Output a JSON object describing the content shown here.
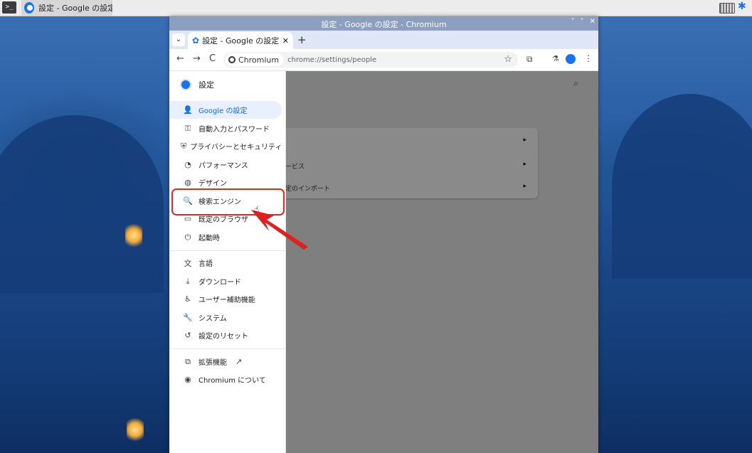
{
  "taskbar": {
    "terminal_icon": "terminal-icon",
    "task_label": "設定 - Google の設定...",
    "keyboard_icon": "keyboard-icon",
    "bluetooth_icon": "bluetooth-icon"
  },
  "window": {
    "title": "設定 - Google の設定 - Chromium",
    "controls": [
      "˅",
      "˄",
      "✕"
    ]
  },
  "tab": {
    "label": "設定 - Google の設定",
    "close": "✕",
    "new_tab": "+"
  },
  "toolbar": {
    "back": "←",
    "forward": "→",
    "reload": "C",
    "site_label": "Chromium",
    "url": "chrome://settings/people",
    "star": "☆",
    "menu": "⋮"
  },
  "sidebar": {
    "title": "設定",
    "items": [
      {
        "label": "Google の設定",
        "icon": "👤"
      },
      {
        "label": "自動入力とパスワード",
        "icon": "⚿"
      },
      {
        "label": "プライバシーとセキュリティ",
        "icon": "⛨"
      },
      {
        "label": "パフォーマンス",
        "icon": "◔"
      },
      {
        "label": "デザイン",
        "icon": "◍"
      },
      {
        "label": "検索エンジン",
        "icon": "🔍"
      },
      {
        "label": "既定のブラウザ",
        "icon": "▭"
      },
      {
        "label": "起動時",
        "icon": "⏻"
      },
      {
        "label": "言語",
        "icon": "文"
      },
      {
        "label": "ダウンロード",
        "icon": "⤓"
      },
      {
        "label": "ユーザー補助機能",
        "icon": "♿"
      },
      {
        "label": "システム",
        "icon": "🔧"
      },
      {
        "label": "設定のリセット",
        "icon": "↺"
      },
      {
        "label": "拡張機能",
        "icon": "⧉"
      },
      {
        "label": "Chromium について",
        "icon": "◉"
      }
    ]
  },
  "main": {
    "rows": [
      {
        "label": "",
        "chevron": "▸"
      },
      {
        "label": "ービス",
        "chevron": "▸"
      },
      {
        "label": "定のインポート",
        "chevron": "▸"
      }
    ]
  },
  "colors": {
    "accent": "#1a73e8",
    "highlight": "#e22222",
    "overlay": "#7f7f7f"
  }
}
